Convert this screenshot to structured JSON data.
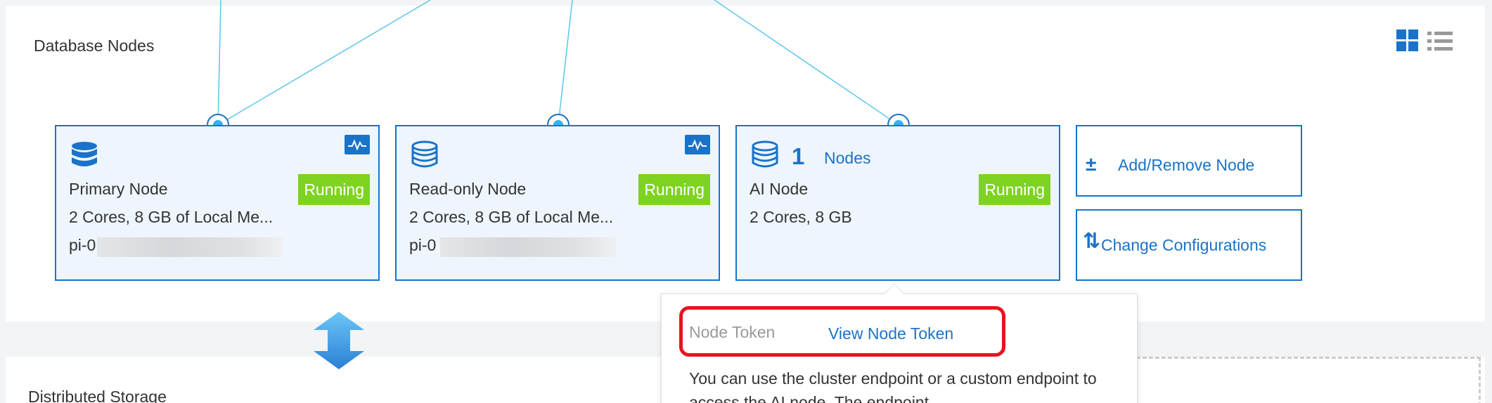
{
  "section": {
    "database_nodes": "Database Nodes",
    "distributed_storage": "Distributed Storage"
  },
  "nodes": {
    "primary": {
      "name": "Primary Node",
      "status": "Running",
      "spec": "2 Cores, 8 GB of Local Me...",
      "id_prefix": "pi-0"
    },
    "readonly": {
      "name": "Read-only Node",
      "status": "Running",
      "spec": "2 Cores, 8 GB of Local Me...",
      "id_prefix": "pi-0"
    },
    "ai": {
      "count": "1",
      "count_label": "Nodes",
      "name": "AI Node",
      "status": "Running",
      "spec": "2 Cores, 8 GB"
    }
  },
  "actions": {
    "add_remove": "Add/Remove Node",
    "add_remove_icon": "±",
    "change_config": "Change Configurations",
    "change_config_icon": "⇅"
  },
  "popover": {
    "token_label": "Node Token",
    "token_link": "View Node Token",
    "description": "You can use the cluster endpoint or a custom endpoint to access the AI node. The endpoint"
  },
  "colors": {
    "accent": "#1a73c8",
    "status_running": "#7ed321",
    "highlight": "#e8131f"
  },
  "icons": {
    "view_grid": "grid-view-icon",
    "view_list": "list-view-icon",
    "database": "database-icon",
    "monitor": "monitor-icon",
    "sync": "sync-arrow-icon"
  }
}
